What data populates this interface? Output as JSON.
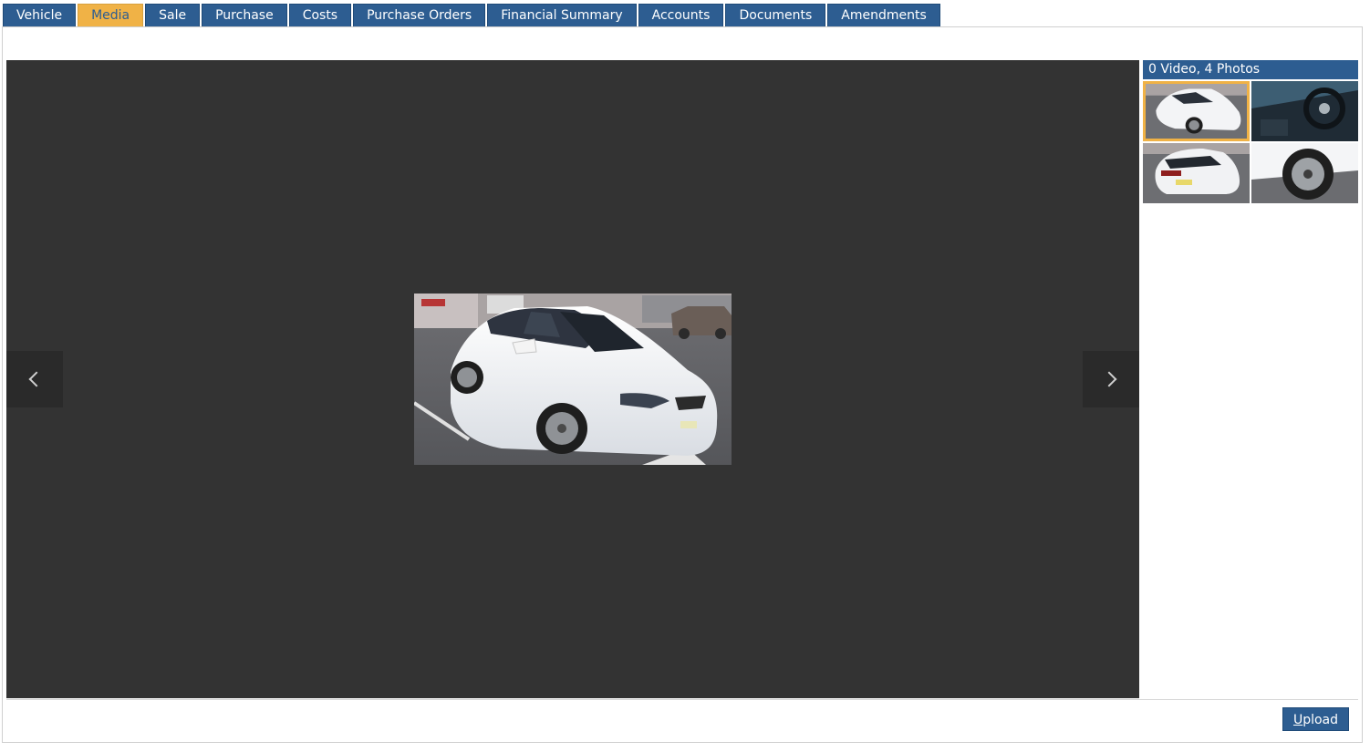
{
  "tabs": [
    {
      "label": "Vehicle",
      "active": false
    },
    {
      "label": "Media",
      "active": true
    },
    {
      "label": "Sale",
      "active": false
    },
    {
      "label": "Purchase",
      "active": false
    },
    {
      "label": "Costs",
      "active": false
    },
    {
      "label": "Purchase Orders",
      "active": false
    },
    {
      "label": "Financial Summary",
      "active": false
    },
    {
      "label": "Accounts",
      "active": false
    },
    {
      "label": "Documents",
      "active": false
    },
    {
      "label": "Amendments",
      "active": false
    }
  ],
  "viewer": {
    "prev_icon": "chevron-left-icon",
    "next_icon": "chevron-right-icon"
  },
  "gallery": {
    "header": "0 Video, 4 Photos",
    "selected_index": 0,
    "thumbnails": [
      {
        "subject": "car-front-three-quarter"
      },
      {
        "subject": "car-interior-dashboard"
      },
      {
        "subject": "car-rear-three-quarter"
      },
      {
        "subject": "car-wheel-closeup"
      }
    ]
  },
  "footer": {
    "upload_label_first": "U",
    "upload_label_rest": "pload"
  },
  "colors": {
    "tab_bg": "#2d5d91",
    "tab_active_bg": "#f0b246",
    "viewer_bg": "#333333"
  }
}
